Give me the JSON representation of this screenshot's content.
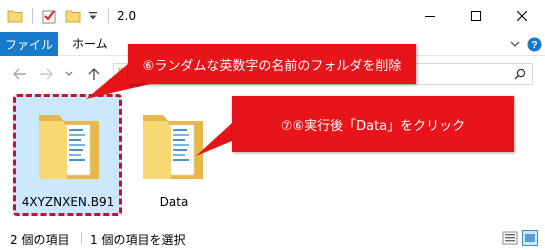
{
  "window": {
    "title": "2.0"
  },
  "ribbon": {
    "tabs": [
      {
        "label": "ファイル",
        "active": true
      },
      {
        "label": "ホーム",
        "active": false
      }
    ]
  },
  "files": [
    {
      "name": "4XYZNXEN.B91",
      "selected": true,
      "icon": "folder-icon"
    },
    {
      "name": "Data",
      "selected": false,
      "icon": "folder-icon"
    }
  ],
  "callouts": {
    "first": "⑥ランダムな英数字の名前のフォルダを削除",
    "second": "⑦⑥実行後「Data」をクリック"
  },
  "status": {
    "item_count": "2 個の項目",
    "selected_count": "1 個の項目を選択"
  },
  "colors": {
    "file_tab": "#1979ca",
    "callout": "#e7141a",
    "selection": "#cce8ff",
    "highlight_border": "#c8102e",
    "folder": "#f8d775"
  }
}
